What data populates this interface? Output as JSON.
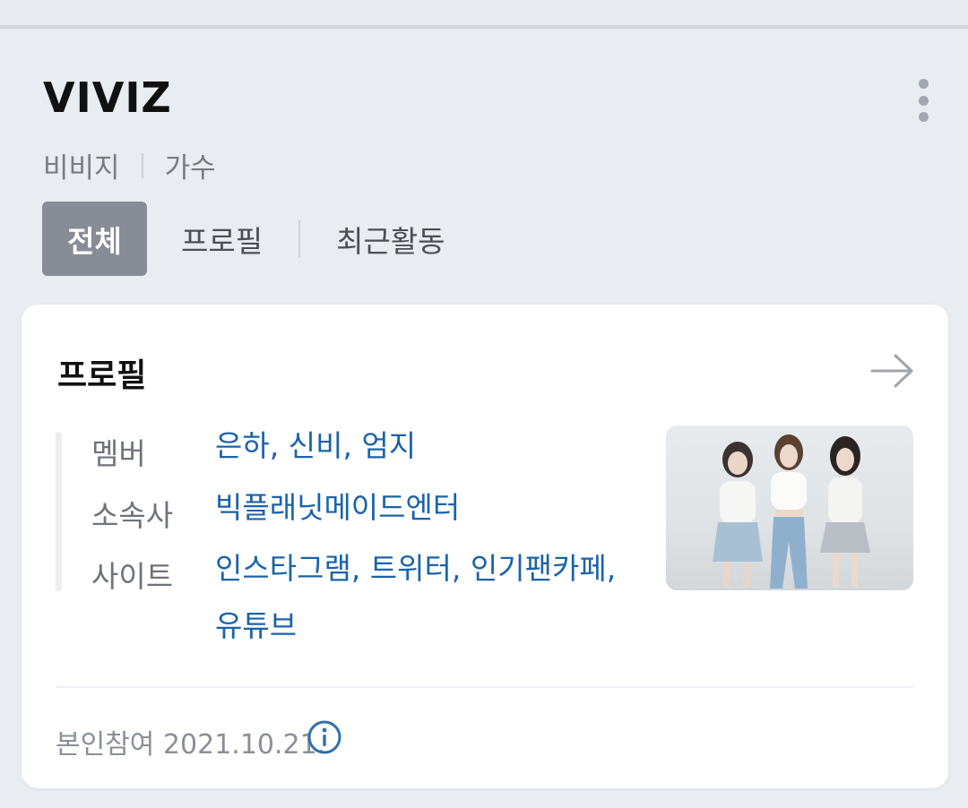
{
  "header": {
    "title": "VIVIZ",
    "subtitle_name": "비비지",
    "subtitle_category": "가수"
  },
  "tabs": [
    {
      "label": "전체",
      "active": true
    },
    {
      "label": "프로필",
      "active": false
    },
    {
      "label": "최근활동",
      "active": false
    }
  ],
  "profile_card": {
    "title": "프로필",
    "rows": {
      "member": {
        "label": "멤버",
        "links": [
          "은하",
          "신비",
          "엄지"
        ]
      },
      "agency": {
        "label": "소속사",
        "value": "빅플래닛메이드엔터"
      },
      "site": {
        "label": "사이트",
        "links": [
          "인스타그램",
          "트위터",
          "인기팬카페",
          "유튜브"
        ]
      }
    },
    "footer": "본인참여 2021.10.21."
  },
  "colors": {
    "background": "#e9ecf1",
    "active_tab": "#878c96",
    "link": "#1a63a9",
    "card": "#ffffff"
  },
  "icons": {
    "more": "more-vertical-icon",
    "arrow": "arrow-right-icon",
    "info": "info-icon"
  }
}
